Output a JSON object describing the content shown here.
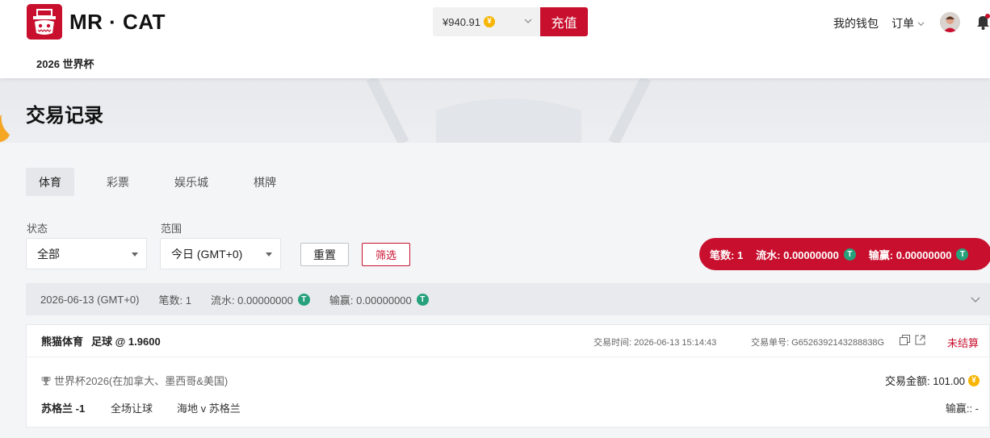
{
  "header": {
    "brand": "MR · CAT",
    "nav_world_cup": "2026 世界杯",
    "balance": "¥940.91",
    "recharge_label": "充值",
    "wallet_label": "我的钱包",
    "orders_label": "订单"
  },
  "page": {
    "title": "交易记录"
  },
  "tabs": [
    {
      "label": "体育",
      "active": true
    },
    {
      "label": "彩票",
      "active": false
    },
    {
      "label": "娱乐城",
      "active": false
    },
    {
      "label": "棋牌",
      "active": false
    }
  ],
  "filters": {
    "status_label": "状态",
    "status_value": "全部",
    "range_label": "范围",
    "range_value": "今日 (GMT+0)",
    "reset_label": "重置",
    "filter_label": "筛选"
  },
  "summary": {
    "count": "笔数: 1",
    "turnover": "流水: 0.00000000",
    "winloss": "输赢: 0.00000000"
  },
  "day": {
    "date": "2026-06-13 (GMT+0)",
    "count": "笔数: 1",
    "turnover": "流水: 0.00000000",
    "winloss": "输赢: 0.00000000"
  },
  "bet": {
    "provider": "熊猫体育",
    "type": "足球 @ 1.9600",
    "time": "交易时间: 2026-06-13 15:14:43",
    "order_no": "交易单号: G6526392143288838G",
    "status": "未结算",
    "league": "世界杯2026(在加拿大、墨西哥&美国)",
    "amount": "交易金额: 101.00",
    "pick": "苏格兰 -1",
    "market": "全场让球",
    "match": "海地 v 苏格兰",
    "winloss": "输赢:: -"
  },
  "colors": {
    "brand_red": "#c8102e",
    "usdt_green": "#26a17b",
    "coin_gold": "#f7b500"
  },
  "icons": {
    "coin": "¥",
    "usdt": "T"
  }
}
